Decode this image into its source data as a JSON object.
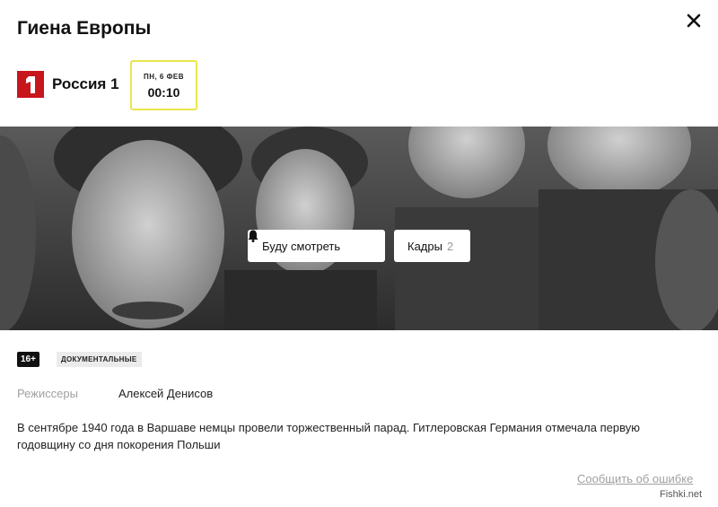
{
  "program": {
    "title": "Гиена Европы",
    "channel": {
      "name": "Россия 1",
      "logo_glyph": "1",
      "logo_color": "#c8161d"
    },
    "schedule": {
      "day": "ПН, 6 ФЕВ",
      "time": "00:10",
      "highlight_color": "#ebe54b"
    }
  },
  "actions": {
    "watch_label": "Буду смотреть",
    "frames_label": "Кадры",
    "frames_count": "2"
  },
  "meta": {
    "age_rating": "16+",
    "genre": "ДОКУМЕНТАЛЬНЫЕ",
    "credits": [
      {
        "label": "Режиссеры",
        "value": "Алексей Денисов"
      }
    ]
  },
  "description": "В сентябре 1940 года в Варшаве немцы провели торжественный парад. Гитлеровская Германия отмечала первую годовщину со дня покорения Польши",
  "footer": {
    "report_label": "Сообщить об ошибке"
  },
  "watermark": "Fishki.net",
  "icons": {
    "close": "close-icon",
    "bell": "bell-icon"
  }
}
